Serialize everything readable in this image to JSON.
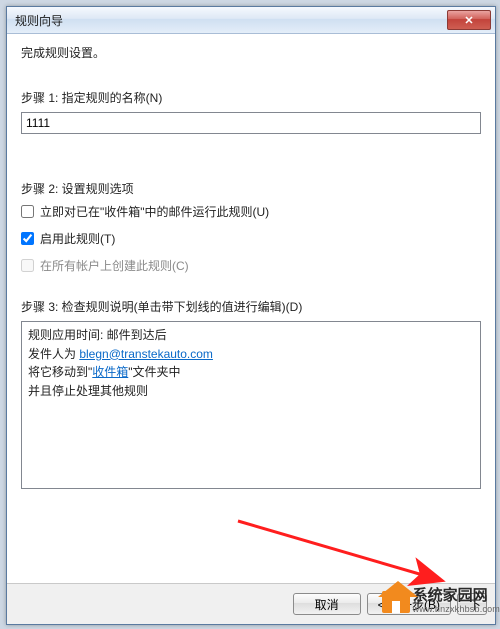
{
  "window": {
    "title": "规则向导",
    "close_glyph": "✕"
  },
  "content": {
    "subtitle": "完成规则设置。",
    "step1_label": "步骤 1: 指定规则的名称(N)",
    "rule_name_value": "1111",
    "step2_label": "步骤 2: 设置规则选项",
    "opt_run_now": {
      "label": "立即对已在\"收件箱\"中的邮件运行此规则(U)",
      "checked": false,
      "disabled": false
    },
    "opt_enable": {
      "label": "启用此规则(T)",
      "checked": true,
      "disabled": false
    },
    "opt_all_accounts": {
      "label": "在所有帐户上创建此规则(C)",
      "checked": false,
      "disabled": true
    },
    "step3_label": "步骤 3: 检查规则说明(单击带下划线的值进行编辑)(D)",
    "desc": {
      "line1": "规则应用时间: 邮件到达后",
      "line2_prefix": "发件人为 ",
      "line2_link": "blegn@transtekauto.com",
      "line3_prefix": "将它移动到\"",
      "line3_link": "收件箱",
      "line3_suffix": "\"文件夹中",
      "line4": "  并且停止处理其他规则"
    }
  },
  "buttons": {
    "cancel": "取消",
    "back": "< 上一步(B)",
    "next_cut": "下"
  },
  "watermark": {
    "cn": "系统家园网",
    "en": "www.hnzxkhbsb.com"
  }
}
